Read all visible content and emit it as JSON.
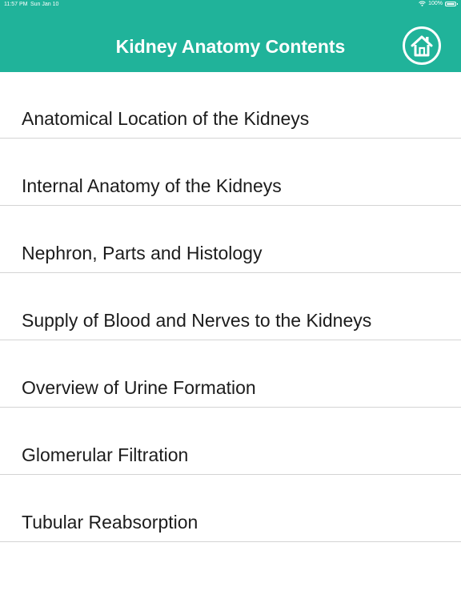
{
  "status_bar": {
    "time": "11:57 PM",
    "date": "Sun Jan 10",
    "battery": "100%"
  },
  "header": {
    "title": "Kidney Anatomy Contents",
    "background_color": "#20b39a",
    "home_icon": "home-icon"
  },
  "contents": {
    "items": [
      {
        "label": "Anatomical Location of the Kidneys"
      },
      {
        "label": "Internal Anatomy of the Kidneys"
      },
      {
        "label": "Nephron, Parts and Histology"
      },
      {
        "label": "Supply of Blood and Nerves to the Kidneys"
      },
      {
        "label": "Overview of Urine Formation"
      },
      {
        "label": "Glomerular Filtration"
      },
      {
        "label": "Tubular Reabsorption"
      }
    ]
  }
}
